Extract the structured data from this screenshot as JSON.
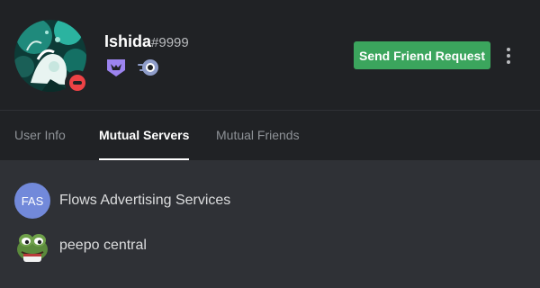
{
  "profile": {
    "username": "Ishida",
    "discriminator": "#9999",
    "status": "do-not-disturb",
    "badges": [
      "hypesquad-icon",
      "nitro-boost-icon"
    ]
  },
  "actions": {
    "send_friend_request_label": "Send Friend Request",
    "more_icon": "more-vertical-icon"
  },
  "tabs": [
    {
      "label": "User Info",
      "active": false
    },
    {
      "label": "Mutual Servers",
      "active": true
    },
    {
      "label": "Mutual Friends",
      "active": false
    }
  ],
  "mutual_servers": [
    {
      "icon_text": "FAS",
      "name": "Flows Advertising Services"
    },
    {
      "icon": "peepo-frog-icon",
      "name": "peepo central"
    }
  ],
  "colors": {
    "background": "#2f3136",
    "header": "#202225",
    "accent_green": "#3ba55d",
    "blurple": "#7289da",
    "dnd_red": "#ed4245",
    "hypesquad_purple": "#9c84ef"
  }
}
